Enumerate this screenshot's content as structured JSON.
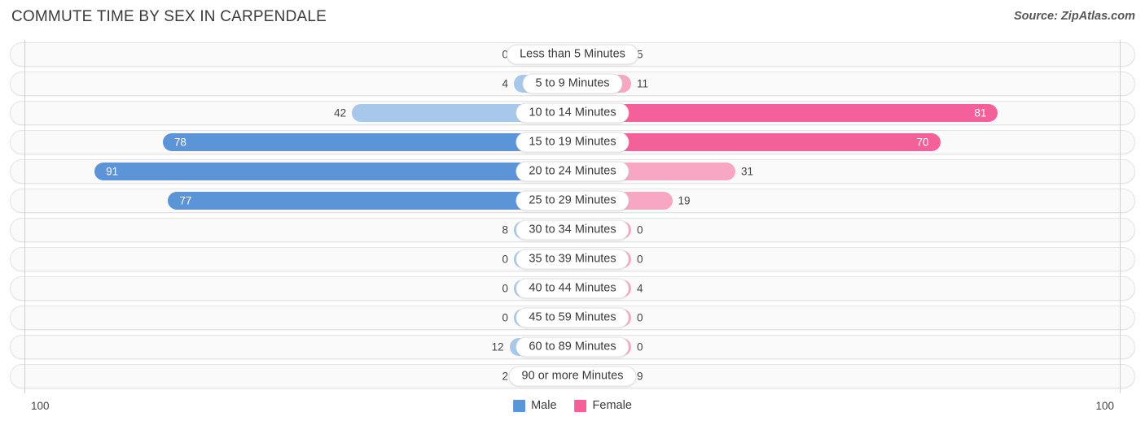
{
  "header": {
    "title": "COMMUTE TIME BY SEX IN CARPENDALE",
    "source": "Source: ZipAtlas.com"
  },
  "axis": {
    "left_tick": "100",
    "right_tick": "100"
  },
  "legend": {
    "items": [
      {
        "label": "Male",
        "color": "#5b95d8"
      },
      {
        "label": "Female",
        "color": "#f4619a"
      }
    ]
  },
  "colors": {
    "male_light": "#a8c8ea",
    "male_strong": "#5b95d8",
    "female_light": "#f7a7c3",
    "female_strong": "#f4619a",
    "row_background": "#fafafa",
    "row_border": "#e4e4e4"
  },
  "chart_data": {
    "type": "bar",
    "orientation": "horizontal-diverging",
    "title": "COMMUTE TIME BY SEX IN CARPENDALE",
    "xlabel": "",
    "ylabel": "",
    "xlim": [
      100,
      100
    ],
    "axis_max": 100,
    "grid": false,
    "legend_position": "bottom-center",
    "categories": [
      "Less than 5 Minutes",
      "5 to 9 Minutes",
      "10 to 14 Minutes",
      "15 to 19 Minutes",
      "20 to 24 Minutes",
      "25 to 29 Minutes",
      "30 to 34 Minutes",
      "35 to 39 Minutes",
      "40 to 44 Minutes",
      "45 to 59 Minutes",
      "60 to 89 Minutes",
      "90 or more Minutes"
    ],
    "series": [
      {
        "name": "Male",
        "values": [
          0,
          4,
          42,
          78,
          91,
          77,
          8,
          0,
          0,
          0,
          12,
          2
        ]
      },
      {
        "name": "Female",
        "values": [
          5,
          11,
          81,
          70,
          31,
          19,
          0,
          0,
          4,
          0,
          0,
          9
        ]
      }
    ]
  },
  "rows": [
    {
      "label": "Less than 5 Minutes",
      "male": "0",
      "female": "5",
      "male_value": 0,
      "female_value": 5
    },
    {
      "label": "5 to 9 Minutes",
      "male": "4",
      "female": "11",
      "male_value": 4,
      "female_value": 11
    },
    {
      "label": "10 to 14 Minutes",
      "male": "42",
      "female": "81",
      "male_value": 42,
      "female_value": 81
    },
    {
      "label": "15 to 19 Minutes",
      "male": "78",
      "female": "70",
      "male_value": 78,
      "female_value": 70
    },
    {
      "label": "20 to 24 Minutes",
      "male": "91",
      "female": "31",
      "male_value": 91,
      "female_value": 31
    },
    {
      "label": "25 to 29 Minutes",
      "male": "77",
      "female": "19",
      "male_value": 77,
      "female_value": 19
    },
    {
      "label": "30 to 34 Minutes",
      "male": "8",
      "female": "0",
      "male_value": 8,
      "female_value": 0
    },
    {
      "label": "35 to 39 Minutes",
      "male": "0",
      "female": "0",
      "male_value": 0,
      "female_value": 0
    },
    {
      "label": "40 to 44 Minutes",
      "male": "0",
      "female": "4",
      "male_value": 0,
      "female_value": 4
    },
    {
      "label": "45 to 59 Minutes",
      "male": "0",
      "female": "0",
      "male_value": 0,
      "female_value": 0
    },
    {
      "label": "60 to 89 Minutes",
      "male": "12",
      "female": "0",
      "male_value": 12,
      "female_value": 0
    },
    {
      "label": "90 or more Minutes",
      "male": "2",
      "female": "9",
      "male_value": 2,
      "female_value": 9
    }
  ]
}
